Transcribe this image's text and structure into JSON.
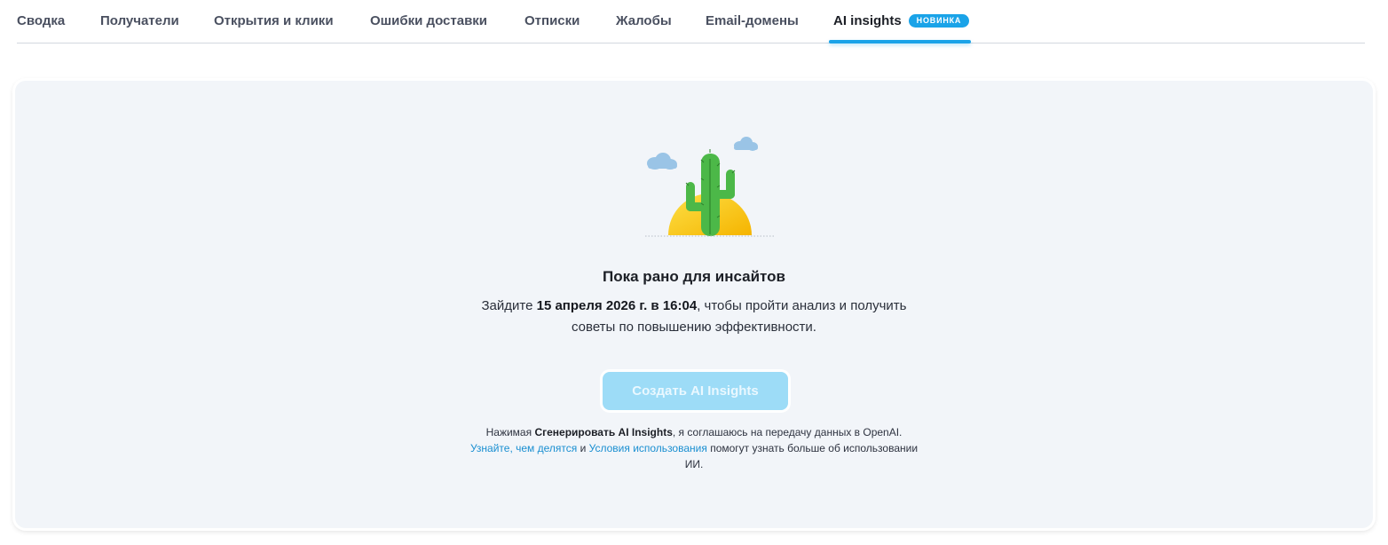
{
  "tabs": [
    {
      "label": "Сводка"
    },
    {
      "label": "Получатели"
    },
    {
      "label": "Открытия и клики"
    },
    {
      "label": "Ошибки доставки"
    },
    {
      "label": "Отписки"
    },
    {
      "label": "Жалобы"
    },
    {
      "label": "Email-домены"
    },
    {
      "label": "AI insights",
      "badge": "НОВИНКА",
      "active": true
    }
  ],
  "colors": {
    "accent": "#1aa3e8",
    "card_bg": "#f2f5f9",
    "button_disabled": "#9ddcf7",
    "link": "#1a8fd1"
  },
  "illustration": {
    "icon": "cactus-sun-icon",
    "clouds": [
      "cloud-icon",
      "cloud-icon"
    ]
  },
  "empty_state": {
    "title": "Пока рано для инсайтов",
    "desc_prefix": "Зайдите ",
    "desc_date": "15 апреля 2026 г. в 16:04",
    "desc_suffix": ", чтобы пройти анализ и получить советы по повышению эффективности."
  },
  "create_button": {
    "label": "Создать AI Insights",
    "disabled": true
  },
  "disclaimer": {
    "prefix": "Нажимая ",
    "bold": "Сгенерировать AI Insights",
    "middle": ", я соглашаюсь на передачу данных в OpenAI.",
    "link1": "Узнайте, чем делятся",
    "and": " и ",
    "link2": "Условия использования",
    "suffix": " помогут узнать больше об использовании ИИ."
  }
}
